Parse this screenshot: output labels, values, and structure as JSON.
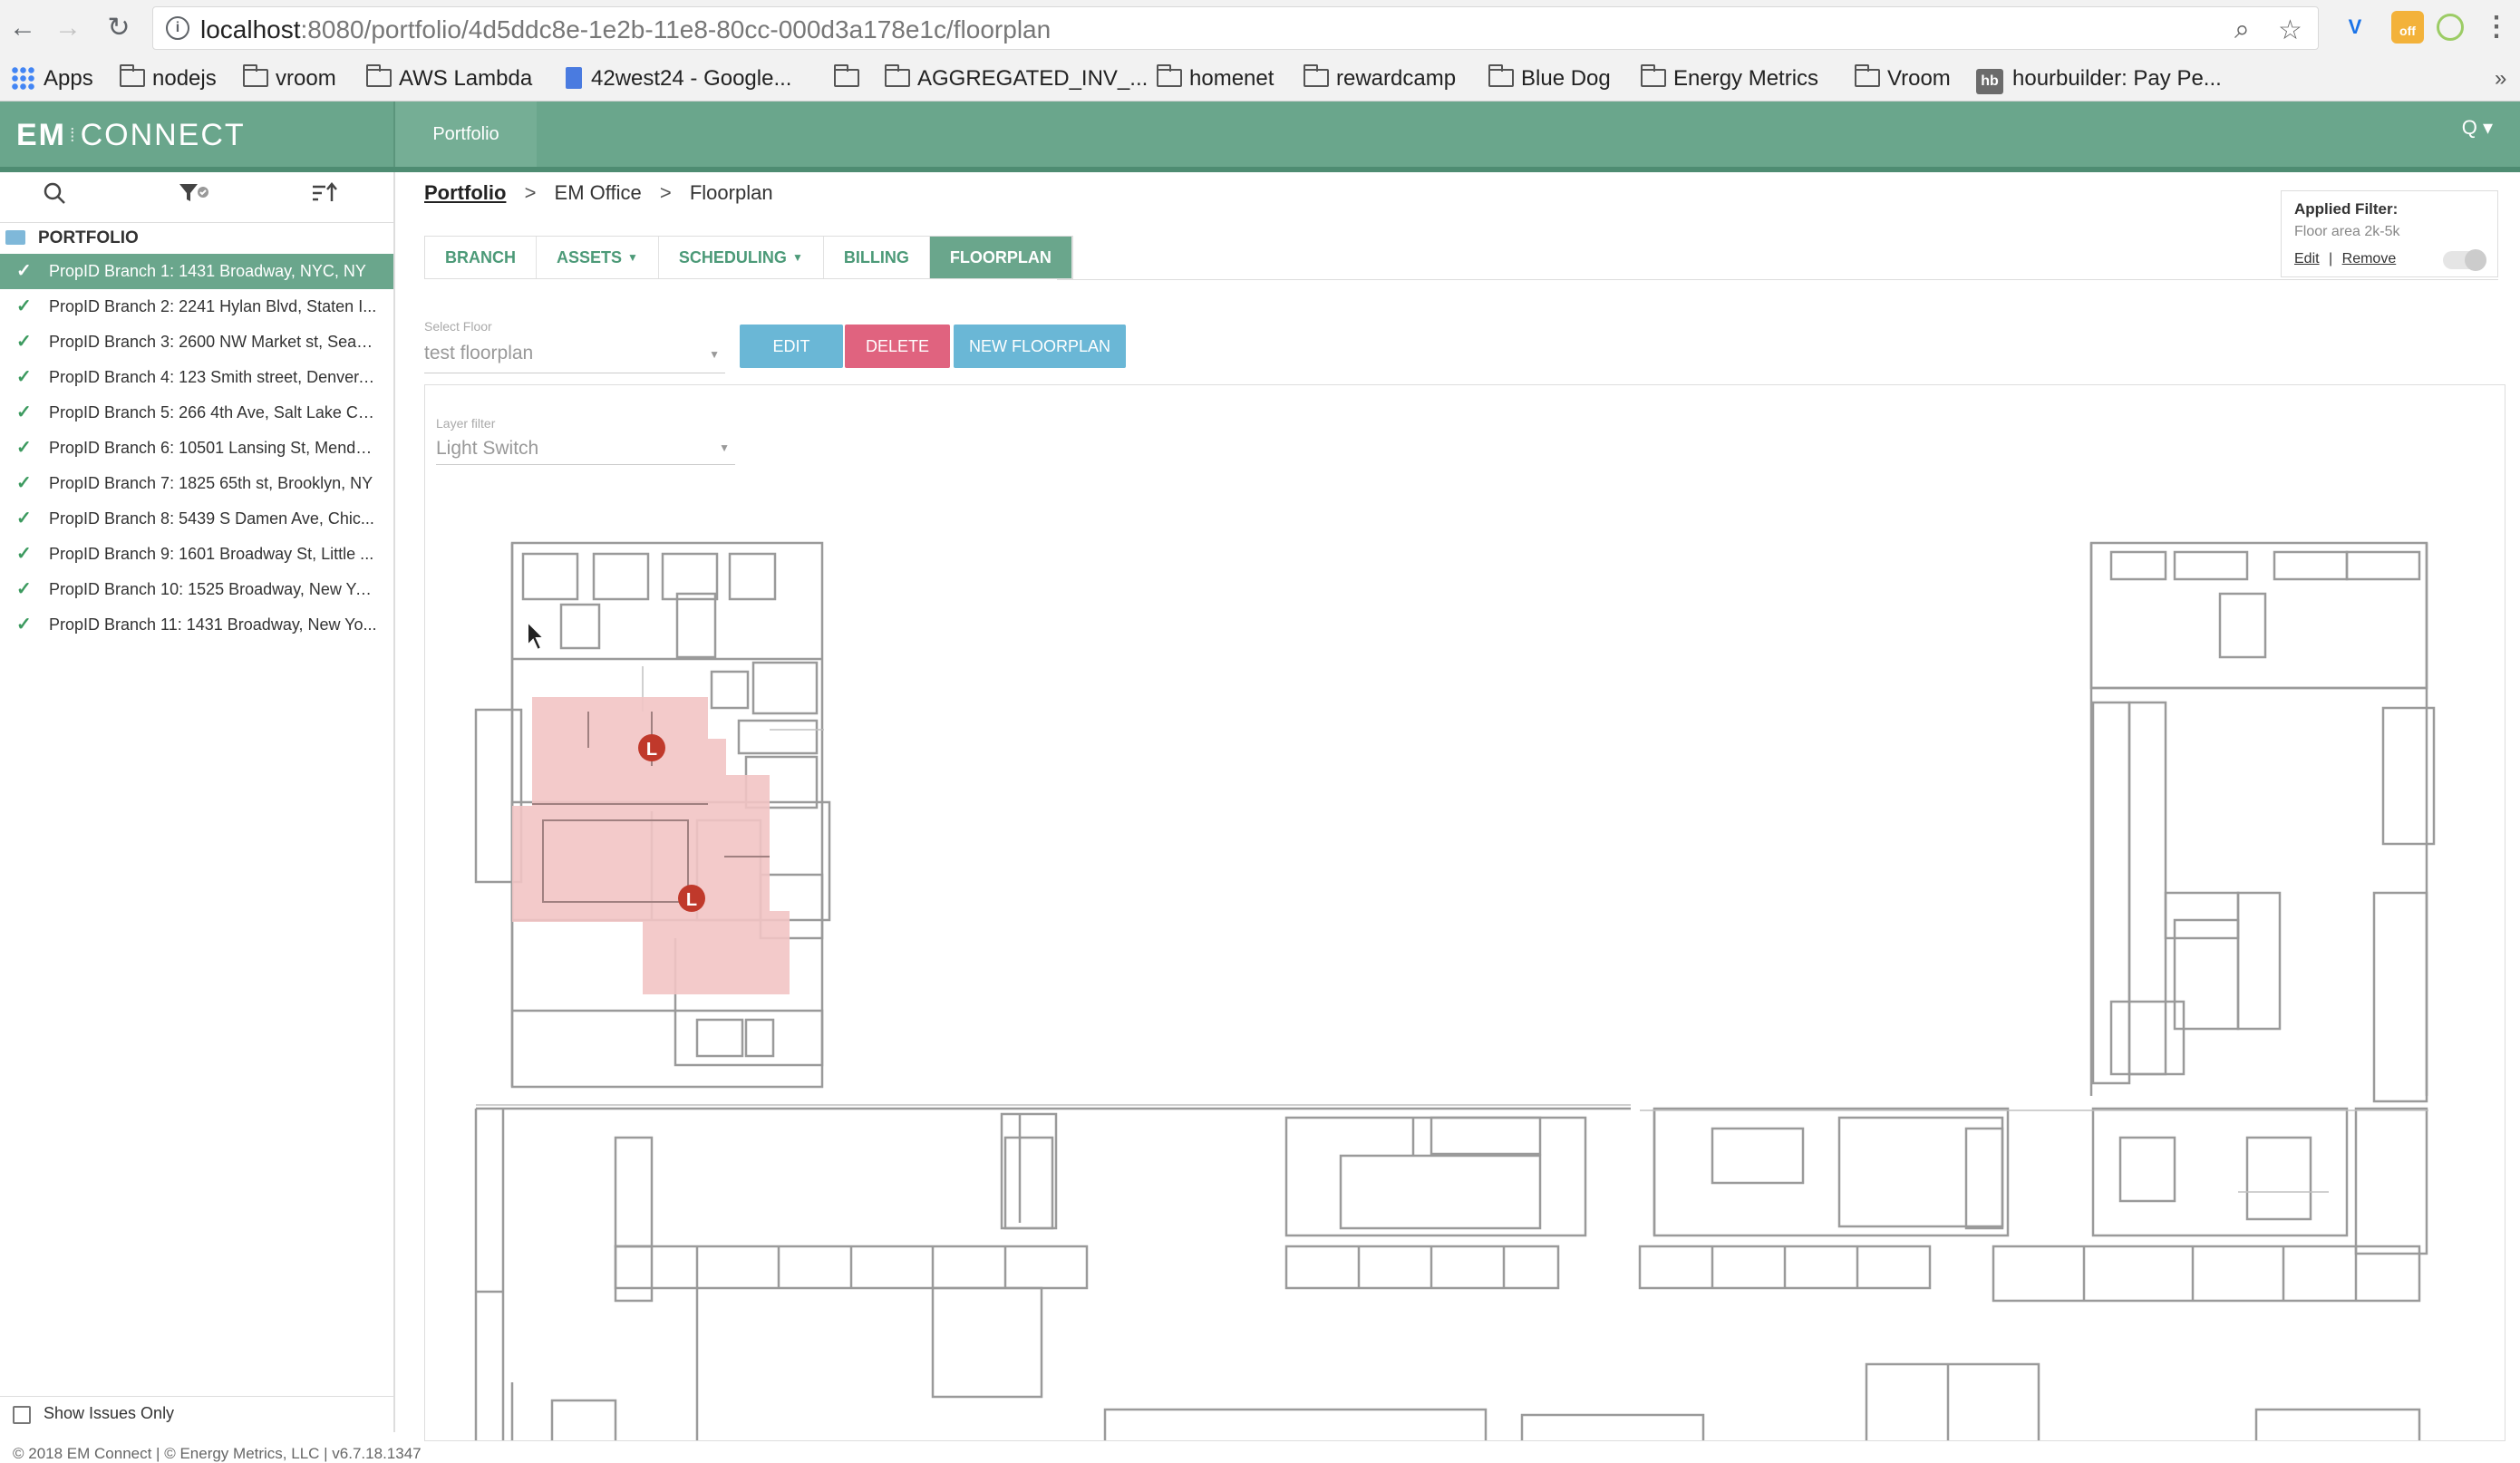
{
  "browser": {
    "url_host": "localhost",
    "url_rest": ":8080/portfolio/4d5ddc8e-1e2b-11e8-80cc-000d3a178e1c/floorplan",
    "extension_off_label": "off",
    "bookmarks": [
      {
        "label": "Apps",
        "icon": "apps-grid-icon"
      },
      {
        "label": "nodejs",
        "icon": "folder-icon"
      },
      {
        "label": "vroom",
        "icon": "folder-icon"
      },
      {
        "label": "AWS Lambda",
        "icon": "folder-icon"
      },
      {
        "label": "42west24 - Google...",
        "icon": "google-doc-icon"
      },
      {
        "label": "",
        "icon": "folder-icon"
      },
      {
        "label": "AGGREGATED_INV_...",
        "icon": "folder-icon"
      },
      {
        "label": "homenet",
        "icon": "folder-icon"
      },
      {
        "label": "rewardcamp",
        "icon": "folder-icon"
      },
      {
        "label": "Blue Dog",
        "icon": "folder-icon"
      },
      {
        "label": "Energy Metrics",
        "icon": "folder-icon"
      },
      {
        "label": "Vroom",
        "icon": "folder-icon"
      },
      {
        "label": "hourbuilder: Pay Pe...",
        "icon": "hb-icon"
      }
    ],
    "hb_badge": "hb",
    "more_label": "»"
  },
  "header": {
    "brand_bold": "EM",
    "brand_sep": "⁞",
    "brand_rest": "CONNECT",
    "portfolio_tab": "Portfolio",
    "user_menu": "Q ▾"
  },
  "sidebar": {
    "root_label": "PORTFOLIO",
    "branches": [
      {
        "label": "PropID Branch 1: 1431 Broadway, NYC, NY",
        "active": true
      },
      {
        "label": "PropID Branch 2: 2241 Hylan Blvd, Staten I...",
        "active": false
      },
      {
        "label": "PropID Branch 3: 2600 NW Market st, Seatt...",
        "active": false
      },
      {
        "label": "PropID Branch 4: 123 Smith street, Denver, ...",
        "active": false
      },
      {
        "label": "PropID Branch 5: 266 4th Ave, Salt Lake Cit...",
        "active": false
      },
      {
        "label": "PropID Branch 6: 10501 Lansing St, Mendo...",
        "active": false
      },
      {
        "label": "PropID Branch 7: 1825 65th st, Brooklyn, NY",
        "active": false
      },
      {
        "label": "PropID Branch 8: 5439 S Damen Ave, Chic...",
        "active": false
      },
      {
        "label": "PropID Branch 9: 1601 Broadway St, Little ...",
        "active": false
      },
      {
        "label": "PropID Branch 10: 1525 Broadway, New Yo...",
        "active": false
      },
      {
        "label": "PropID Branch 11: 1431 Broadway, New Yo...",
        "active": false
      }
    ],
    "show_issues_label": "Show Issues Only"
  },
  "footer": {
    "copyright": "© 2018 EM Connect | © Energy Metrics, LLC  |  v6.7.18.1347"
  },
  "breadcrumb": {
    "root": "Portfolio",
    "middle": "EM Office",
    "current": "Floorplan",
    "separator": ">"
  },
  "tabs": [
    {
      "label": "BRANCH",
      "caret": false,
      "active": false
    },
    {
      "label": "ASSETS",
      "caret": true,
      "active": false
    },
    {
      "label": "SCHEDULING",
      "caret": true,
      "active": false
    },
    {
      "label": "BILLING",
      "caret": false,
      "active": false
    },
    {
      "label": "FLOORPLAN",
      "caret": false,
      "active": true
    }
  ],
  "applied_filter": {
    "title": "Applied Filter:",
    "value": "Floor area 2k-5k",
    "edit": "Edit",
    "divider": "|",
    "remove": "Remove"
  },
  "floor_select": {
    "label": "Select Floor",
    "value": "test floorplan"
  },
  "actions": {
    "edit": "EDIT",
    "delete": "DELETE",
    "new_floorplan": "NEW FLOORPLAN"
  },
  "layer_filter": {
    "label": "Layer filter",
    "value": "Light Switch"
  },
  "floorplan": {
    "marker_label": "L",
    "highlight_color": "#f2c4c4",
    "marker_color": "#c0392b"
  },
  "colors": {
    "brand_green": "#6aa68c",
    "tab_text": "#4c9a78",
    "edit_blue": "#6ab7d6",
    "delete_pink": "#e0637f"
  }
}
